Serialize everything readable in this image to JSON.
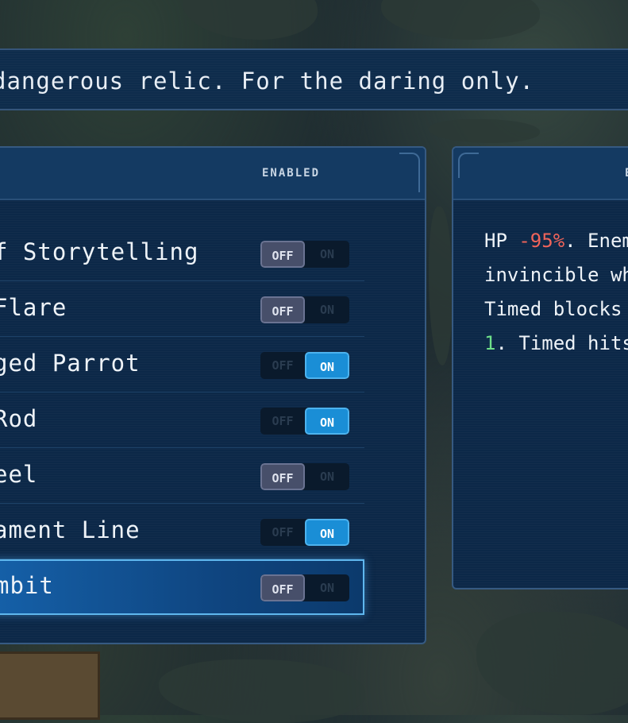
{
  "description": "dangerous relic. For the daring only.",
  "relic_list": {
    "column_header": "ENABLED",
    "items": [
      {
        "label": "f Storytelling",
        "off_label": "OFF",
        "on_label": "ON",
        "enabled": false,
        "selected": false
      },
      {
        "label": "Flare",
        "off_label": "OFF",
        "on_label": "ON",
        "enabled": false,
        "selected": false
      },
      {
        "label": "ged Parrot",
        "off_label": "OFF",
        "on_label": "ON",
        "enabled": true,
        "selected": false
      },
      {
        "label": "Rod",
        "off_label": "OFF",
        "on_label": "ON",
        "enabled": true,
        "selected": false
      },
      {
        "label": "eel",
        "off_label": "OFF",
        "on_label": "ON",
        "enabled": false,
        "selected": false
      },
      {
        "label": "ament Line",
        "off_label": "OFF",
        "on_label": "ON",
        "enabled": true,
        "selected": false
      },
      {
        "label": "mbit",
        "off_label": "OFF",
        "on_label": "ON",
        "enabled": false,
        "selected": true
      }
    ]
  },
  "details_panel": {
    "header": "E",
    "line1_prefix": "HP ",
    "line1_value": "-95%",
    "line1_suffix": ". Enem",
    "line2": "invincible wh",
    "line3": "Timed blocks ",
    "line4_value": "1",
    "line4_suffix": ". Timed hits"
  },
  "colors": {
    "toggle_on": "#1a8ed6",
    "toggle_off": "#474f6a",
    "negative_stat": "#f0645a",
    "positive_number": "#6ee08a",
    "selection_border": "#5fb7ee"
  }
}
